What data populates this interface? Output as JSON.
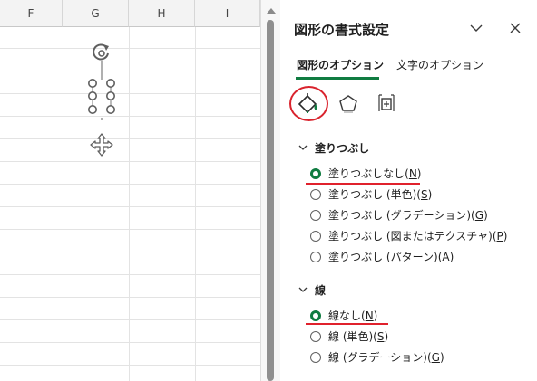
{
  "sheet": {
    "columns": [
      "F",
      "G",
      "H",
      "I"
    ]
  },
  "scrollbar": {},
  "pane": {
    "title": "図形の書式設定",
    "tabs": [
      {
        "label": "図形のオプション",
        "selected": true
      },
      {
        "label": "文字のオプション",
        "selected": false
      }
    ],
    "icons": [
      "fill-line-icon",
      "effects-icon",
      "size-properties-icon"
    ],
    "fill_section": {
      "title": "塗りつぶし",
      "options": [
        {
          "text": "塗りつぶしなし(",
          "key": "N",
          "tail": ")",
          "checked": true
        },
        {
          "text": "塗りつぶし (単色)(",
          "key": "S",
          "tail": ")",
          "checked": false
        },
        {
          "text": "塗りつぶし (グラデーション)(",
          "key": "G",
          "tail": ")",
          "checked": false
        },
        {
          "text": "塗りつぶし (図またはテクスチャ)(",
          "key": "P",
          "tail": ")",
          "checked": false
        },
        {
          "text": "塗りつぶし (パターン)(",
          "key": "A",
          "tail": ")",
          "checked": false
        }
      ]
    },
    "line_section": {
      "title": "線",
      "options": [
        {
          "text": "線なし(",
          "key": "N",
          "tail": ")",
          "checked": true
        },
        {
          "text": "線 (単色)(",
          "key": "S",
          "tail": ")",
          "checked": false
        },
        {
          "text": "線 (グラデーション)(",
          "key": "G",
          "tail": ")",
          "checked": false
        }
      ]
    }
  },
  "colors": {
    "accent": "#107c41",
    "annotation": "#e0212c"
  }
}
